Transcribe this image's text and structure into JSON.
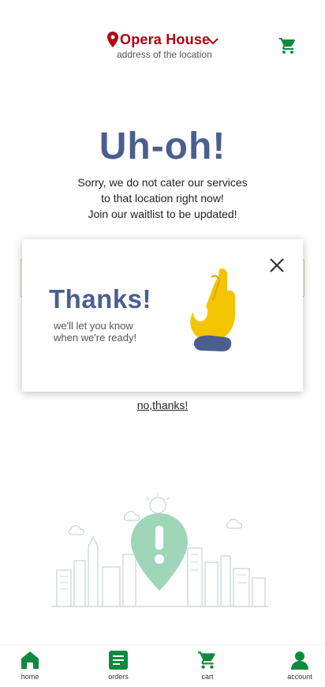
{
  "header": {
    "location_name": "Opera House",
    "location_subtitle": "address of the location"
  },
  "main": {
    "title": "Uh-oh!",
    "message_lines": [
      "Sorry, we do not cater our services",
      "to that location right now!",
      "Join our waitlist to be updated!"
    ],
    "no_thanks_link": "no,thanks!"
  },
  "modal": {
    "title": "Thanks!",
    "subtitle_lines": [
      "we'll let you know",
      "when we're ready!"
    ]
  },
  "bottom_nav": {
    "items": [
      {
        "label": "home",
        "icon": "home-icon"
      },
      {
        "label": "orders",
        "icon": "orders-icon"
      },
      {
        "label": "cart",
        "icon": "cart-icon"
      },
      {
        "label": "account",
        "icon": "account-icon"
      }
    ]
  },
  "colors": {
    "brand_red": "#b3000f",
    "heading_blue": "#4a5f8e",
    "nav_green": "#0d8a3c",
    "illustration_green": "#9fd6b8",
    "hand_yellow": "#f5c400"
  }
}
